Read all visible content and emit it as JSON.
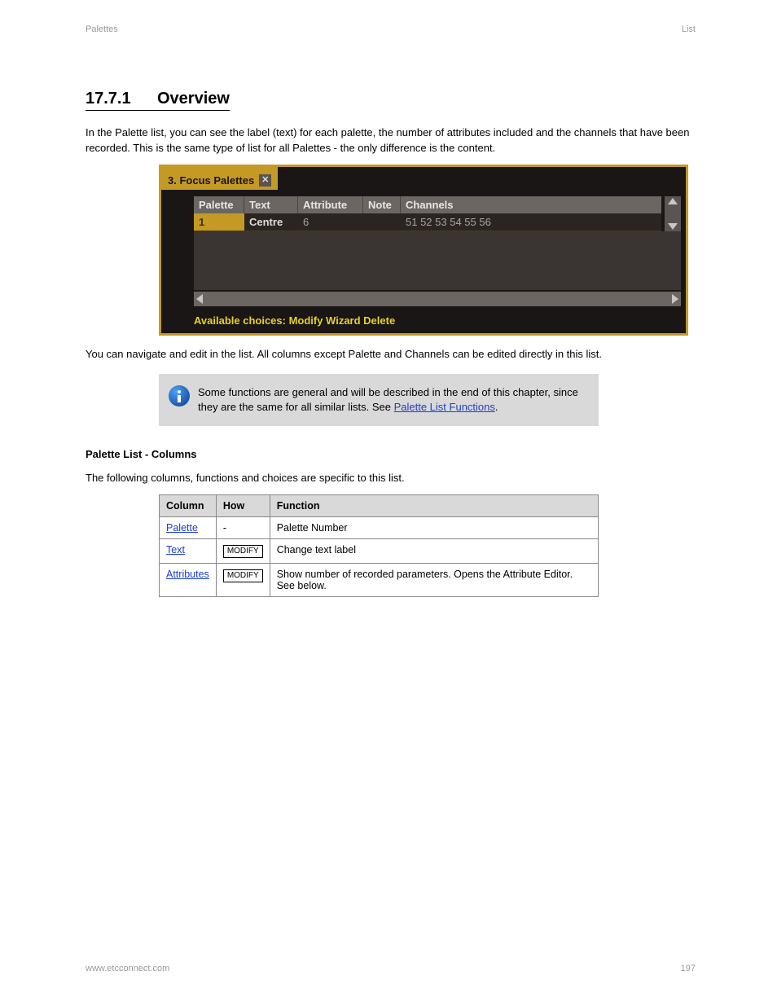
{
  "header": {
    "left": "Palettes",
    "right": "List"
  },
  "section": {
    "number": "17.7.1",
    "title": "Overview",
    "intro": "In the Palette list, you can see the label (text) for each palette, the number of attributes included and the channels that have been recorded. This is the same type of list for all Palettes - the only difference is the content.",
    "below_screenshot": "You can navigate and edit in the list. All columns except Palette and Channels can be edited directly in this list."
  },
  "screenshot": {
    "tab_title": "3. Focus Palettes",
    "headers": {
      "palette": "Palette",
      "text": "Text",
      "attribute": "Attribute",
      "note": "Note",
      "channels": "Channels"
    },
    "row": {
      "palette": "1",
      "text": "Centre",
      "attribute": "6",
      "note": "",
      "channels": "51 52 53 54 55 56"
    },
    "footer": "Available choices: Modify Wizard Delete"
  },
  "callout": {
    "text_before": "Some functions are general and will be described in the end of this chapter, since they are the same for all similar lists. See ",
    "link_text": "Palette List Functions",
    "text_after": "."
  },
  "columns_section": {
    "heading": "Palette List - Columns",
    "intro": "The following columns, functions and choices are specific to this list.",
    "headers": {
      "col": "Column",
      "how": "How",
      "func": "Function"
    },
    "rows": [
      {
        "col": "Palette",
        "how": "-",
        "func": "Palette Number"
      },
      {
        "col": "Text",
        "how_key": "MODIFY",
        "func": "Change text label"
      },
      {
        "col": "Attributes",
        "how_key": "MODIFY",
        "func": "Show number of recorded parameters. Opens the Attribute Editor. See below."
      }
    ]
  },
  "footer": {
    "left": "www.etcconnect.com",
    "right": "197"
  }
}
